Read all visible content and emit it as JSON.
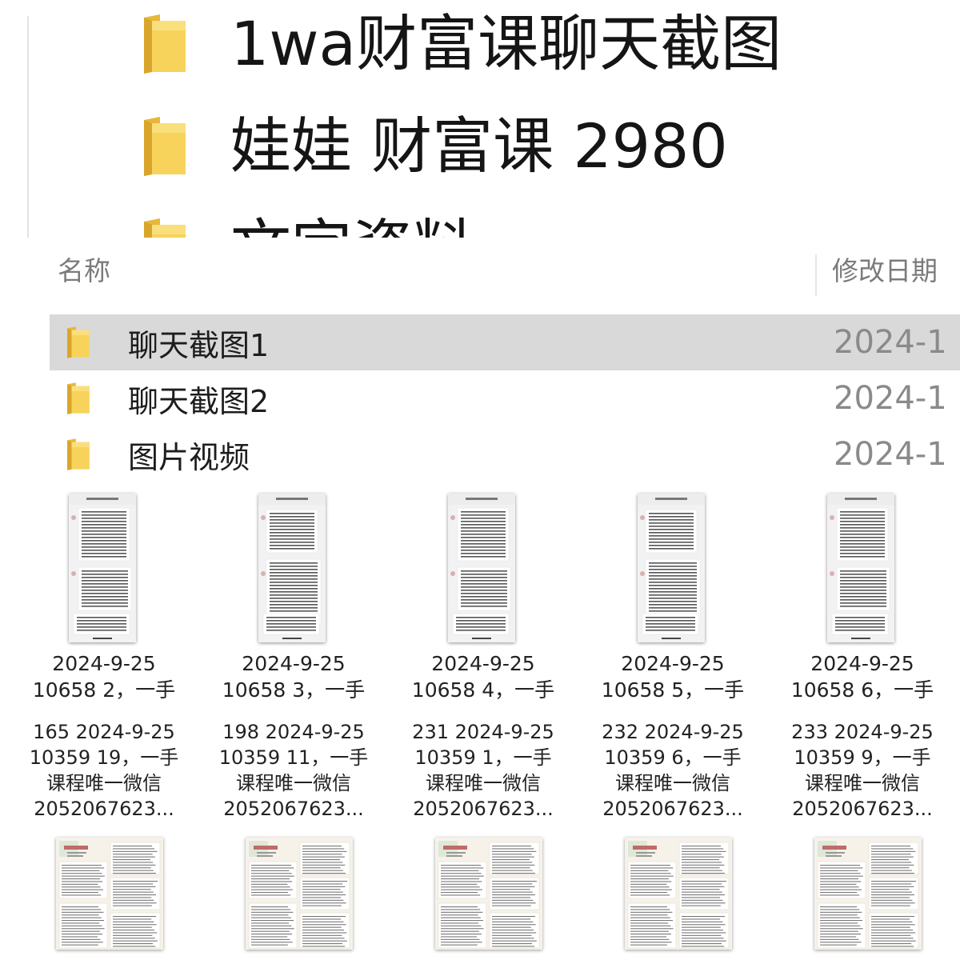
{
  "zoomed_folders": [
    {
      "label": "1wa财富课聊天截图"
    },
    {
      "label": "娃娃 财富课 2980"
    },
    {
      "label": "文字资料"
    }
  ],
  "columns": {
    "name": "名称",
    "date": "修改日期"
  },
  "folders": [
    {
      "name": "聊天截图1",
      "date": "2024-1",
      "selected": true
    },
    {
      "name": "聊天截图2",
      "date": "2024-1",
      "selected": false
    },
    {
      "name": "图片视频",
      "date": "2024-1",
      "selected": false
    }
  ],
  "chat_images": [
    {
      "line1": "2024-9-25",
      "line2": "10658 2，一手"
    },
    {
      "line1": "2024-9-25",
      "line2": "10658 3，一手"
    },
    {
      "line1": "2024-9-25",
      "line2": "10658 4，一手"
    },
    {
      "line1": "2024-9-25",
      "line2": "10658 5，一手"
    },
    {
      "line1": "2024-9-25",
      "line2": "10658 6，一手"
    }
  ],
  "course_images": [
    {
      "line1": "165 2024-9-25",
      "line2": "10359 19，一手",
      "line3": "课程唯一微信",
      "line4": "2052067623..."
    },
    {
      "line1": "198 2024-9-25",
      "line2": "10359 11，一手",
      "line3": "课程唯一微信",
      "line4": "2052067623..."
    },
    {
      "line1": "231 2024-9-25",
      "line2": "10359 1，一手",
      "line3": "课程唯一微信",
      "line4": "2052067623..."
    },
    {
      "line1": "232 2024-9-25",
      "line2": "10359 6，一手",
      "line3": "课程唯一微信",
      "line4": "2052067623..."
    },
    {
      "line1": "233 2024-9-25",
      "line2": "10359 9，一手",
      "line3": "课程唯一微信",
      "line4": "2052067623..."
    }
  ],
  "colors": {
    "folder": "#f5c542",
    "folder_dark": "#e0a92a",
    "selection": "#d9d9d9"
  }
}
